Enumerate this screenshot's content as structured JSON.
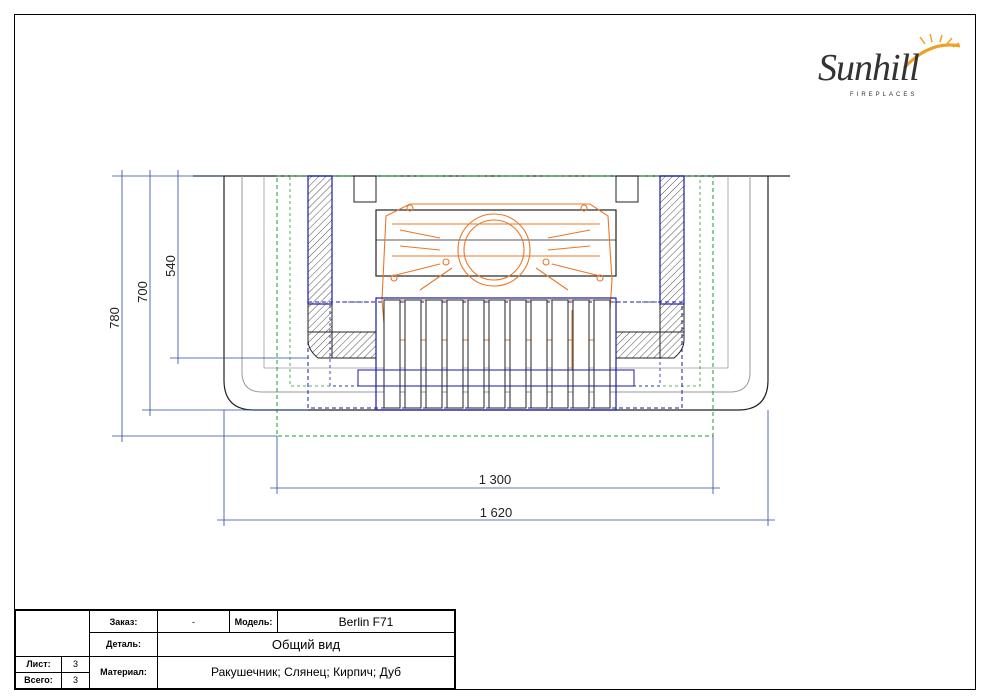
{
  "logo": {
    "name": "Sunhill",
    "subtitle": "FIREPLACES"
  },
  "dimensions": {
    "height_total": "780",
    "height_mid": "700",
    "height_inner": "540",
    "width_inner": "1 300",
    "width_total": "1 620"
  },
  "title_block": {
    "order_label": "Заказ:",
    "order_value": "-",
    "model_label": "Модель:",
    "model_value": "Berlin F71",
    "detail_label": "Деталь:",
    "detail_value": "Общий вид",
    "material_label": "Материал:",
    "material_value": "Ракушечник; Слянец; Кирпич; Дуб",
    "sheet_label": "Лист:",
    "sheet_value": "3",
    "total_label": "Всего:",
    "total_value": "3"
  },
  "colors": {
    "outline": "#222222",
    "firebox": "#e8782a",
    "insulation": "#1a1aa0",
    "guide_green": "#1f9a3a",
    "dimension": "#2a4aa0",
    "gray": "#9a9a9a"
  }
}
